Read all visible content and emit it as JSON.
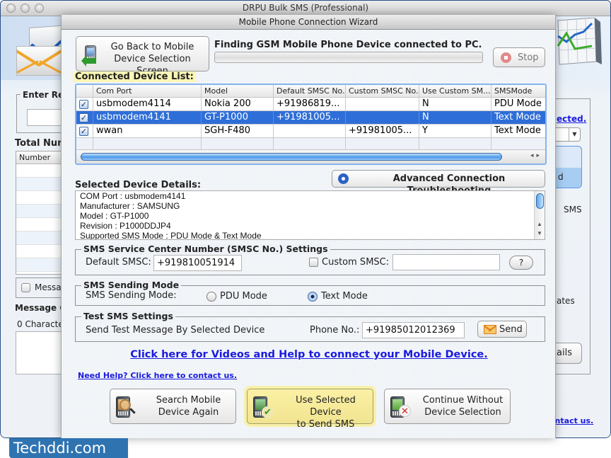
{
  "main_window": {
    "title": "DRPU Bulk SMS (Professional)",
    "background_partial": {
      "enter_recipient_label": "Enter Rec",
      "total_numbers_label": "Total Num",
      "number_column_header": "Number",
      "message_checkbox_label": "Messa",
      "message_composer_label": "Message C",
      "characters_count": "0 Characte",
      "right_link_partial": "ected.",
      "right_list_item_partial": "d",
      "right_sms_label": "SMS",
      "right_templates_partial": "ates",
      "right_details_button_partial": "ails",
      "right_contact_link_partial": "ontact us."
    }
  },
  "dialog": {
    "title": "Mobile Phone Connection Wizard",
    "go_back_button": "Go Back to Mobile Device Selection Screen",
    "go_back_lines": [
      "Go Back to Mobile",
      "Device Selection Screen"
    ],
    "status_text": "Finding GSM Mobile Phone Device connected to PC.",
    "progress": 0,
    "stop_button": "Stop",
    "connected_list_label": "Connected Device List:",
    "device_table": {
      "columns": [
        "Com Port",
        "Model",
        "Default SMSC No.",
        "Custom SMSC No.",
        "Use Custom SM...",
        "SMSMode"
      ],
      "rows": [
        {
          "checked": true,
          "com_port": "usbmodem4114",
          "model": "Nokia 200",
          "default_smsc": "+91986819...",
          "custom_smsc": "",
          "use_custom": "N",
          "sms_mode": "PDU Mode",
          "selected": false
        },
        {
          "checked": true,
          "com_port": "usbmodem4141",
          "model": "GT-P1000",
          "default_smsc": "+91981005...",
          "custom_smsc": "",
          "use_custom": "N",
          "sms_mode": "Text Mode",
          "selected": true
        },
        {
          "checked": true,
          "com_port": "wwan",
          "model": "SGH-F480",
          "default_smsc": "",
          "custom_smsc": "+91981005...",
          "use_custom": "Y",
          "sms_mode": "Text Mode",
          "selected": false
        }
      ]
    },
    "advanced_button": "Advanced Connection Troubleshooting",
    "details_label": "Selected Device Details:",
    "details_lines": [
      "COM Port : usbmodem4141",
      "Manufacturer : SAMSUNG",
      "Model : GT-P1000",
      "Revision : P1000DDJP4",
      "Supported SMS Mode : PDU Mode & Text Mode"
    ],
    "smsc_settings": {
      "legend": "SMS Service Center Number (SMSC No.) Settings",
      "default_label": "Default SMSC:",
      "default_value": "+919810051914",
      "custom_checkbox_label": "Custom SMSC:",
      "custom_checked": false,
      "custom_value": "",
      "help_button": "?"
    },
    "sending_mode": {
      "legend": "SMS Sending Mode",
      "label": "SMS Sending Mode:",
      "options": [
        "PDU Mode",
        "Text Mode"
      ],
      "selected": "Text Mode"
    },
    "test_sms": {
      "legend": "Test SMS Settings",
      "description": "Send Test Message By Selected Device",
      "phone_label": "Phone No.:",
      "phone_value": "+91985012012369",
      "send_button": "Send"
    },
    "videos_link": "Click here for Videos and Help to connect your Mobile Device.",
    "contact_link": "Need Help? Click here to contact us.",
    "bottom_buttons": {
      "search_lines": [
        "Search Mobile",
        "Device Again"
      ],
      "use_lines": [
        "Use Selected Device",
        "to Send SMS"
      ],
      "continue_lines": [
        "Continue Without",
        "Device Selection"
      ]
    },
    "colors": {
      "selected_row": "#2e6ed8",
      "highlight_yellow": "#f7f0a8",
      "link_blue": "#1a1adf"
    }
  },
  "watermark": "Techddi.com"
}
